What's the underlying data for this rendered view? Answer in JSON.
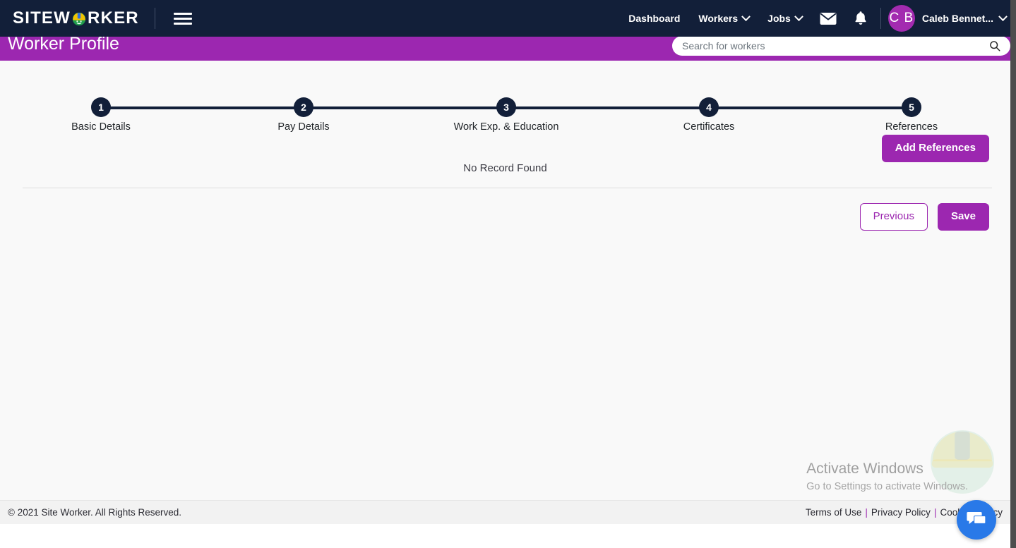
{
  "navbar": {
    "brand_pre": "SITEW",
    "brand_post": "RKER",
    "logo_icon": "hard-hat-worker-icon",
    "menu_icon": "hamburger-menu-icon",
    "links": [
      {
        "label": "Dashboard",
        "has_caret": false
      },
      {
        "label": "Workers",
        "has_caret": true
      },
      {
        "label": "Jobs",
        "has_caret": true
      }
    ],
    "mail_icon": "envelope-icon",
    "bell_icon": "bell-icon",
    "avatar_initials": "C B",
    "user_name": "Caleb Bennet...",
    "accent": "#9c27b0",
    "bar_color": "#121f39"
  },
  "subheader": {
    "title": "Worker Profile",
    "search": {
      "placeholder": "Search for workers",
      "value": "",
      "icon": "search-icon"
    }
  },
  "stepper": {
    "steps": [
      {
        "number": "1",
        "label": "Basic Details"
      },
      {
        "number": "2",
        "label": "Pay Details"
      },
      {
        "number": "3",
        "label": "Work Exp. & Education"
      },
      {
        "number": "4",
        "label": "Certificates"
      },
      {
        "number": "5",
        "label": "References"
      }
    ],
    "active_step": "5"
  },
  "main": {
    "add_button": "Add References",
    "empty_message": "No Record Found",
    "previous_button": "Previous",
    "save_button": "Save"
  },
  "watermark": {
    "title": "Activate Windows",
    "subtitle": "Go to Settings to activate Windows."
  },
  "chat": {
    "icon": "chat-bubble-icon"
  },
  "footer": {
    "copyright": "© 2021 Site Worker. All Rights Reserved.",
    "links": [
      {
        "label": "Terms of Use"
      },
      {
        "label": "Privacy Policy"
      },
      {
        "label": "Cookies Policy"
      }
    ],
    "separator": "|"
  }
}
